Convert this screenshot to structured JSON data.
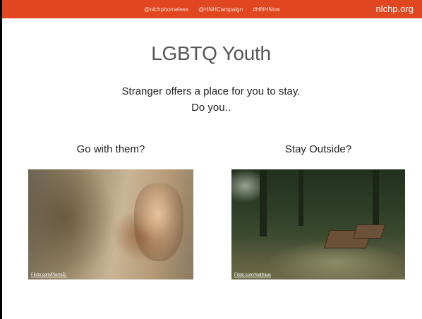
{
  "header": {
    "hashtags": [
      "@nlchphomeless",
      "@HNHCampaign",
      "#HNHNow"
    ],
    "site": "nlchp.org",
    "bar_color": "#e0461f"
  },
  "slide": {
    "title": "LGBTQ Youth",
    "prompt_line1": "Stranger offers a place for you to stay.",
    "prompt_line2": "Do you..",
    "left_choice": "Go with them?",
    "right_choice": "Stay Outside?",
    "left_credit": "Flickr.com/PierreD.",
    "right_credit": "Flickr.com/mattraux"
  }
}
